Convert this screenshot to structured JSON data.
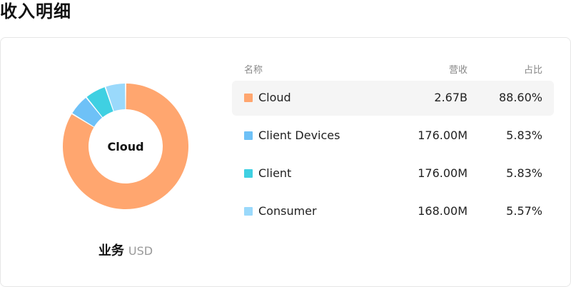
{
  "page": {
    "title": "收入明细"
  },
  "donut": {
    "center_label": "Cloud",
    "caption_main": "业务",
    "caption_unit": "USD",
    "slices": [
      {
        "name": "Cloud",
        "fraction": 0.886,
        "color": "#ffa66f"
      },
      {
        "name": "Client Devices",
        "fraction": 0.0583,
        "color": "#6ec1f7"
      },
      {
        "name": "Client",
        "fraction": 0.0583,
        "color": "#3fd0e2"
      },
      {
        "name": "Consumer",
        "fraction": 0.0557,
        "color": "#9ad9fb"
      }
    ]
  },
  "table": {
    "headers": {
      "name": "名称",
      "revenue": "营收",
      "percent": "占比"
    },
    "rows": [
      {
        "name": "Cloud",
        "revenue": "2.67B",
        "percent": "88.60%",
        "color": "#ffa66f",
        "selected": true
      },
      {
        "name": "Client Devices",
        "revenue": "176.00M",
        "percent": "5.83%",
        "color": "#6ec1f7",
        "selected": false
      },
      {
        "name": "Client",
        "revenue": "176.00M",
        "percent": "5.83%",
        "color": "#3fd0e2",
        "selected": false
      },
      {
        "name": "Consumer",
        "revenue": "168.00M",
        "percent": "5.57%",
        "color": "#9ad9fb",
        "selected": false
      }
    ]
  }
}
